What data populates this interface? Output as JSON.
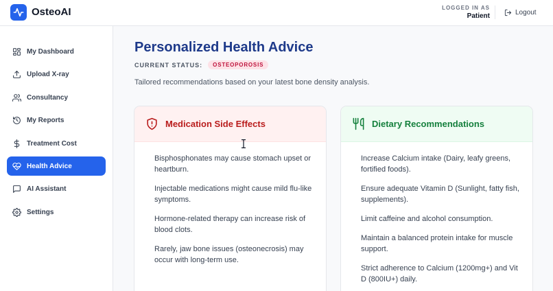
{
  "app": {
    "name": "OsteoAI"
  },
  "header": {
    "logged_in_label": "LOGGED IN AS",
    "user_role": "Patient",
    "logout_label": "Logout"
  },
  "sidebar": {
    "items": [
      {
        "label": "My Dashboard",
        "icon": "dashboard-grid-icon",
        "active": false
      },
      {
        "label": "Upload X-ray",
        "icon": "upload-icon",
        "active": false
      },
      {
        "label": "Consultancy",
        "icon": "users-icon",
        "active": false
      },
      {
        "label": "My Reports",
        "icon": "history-icon",
        "active": false
      },
      {
        "label": "Treatment Cost",
        "icon": "dollar-icon",
        "active": false
      },
      {
        "label": "Health Advice",
        "icon": "heart-pulse-icon",
        "active": true
      },
      {
        "label": "AI Assistant",
        "icon": "chat-icon",
        "active": false
      },
      {
        "label": "Settings",
        "icon": "gear-icon",
        "active": false
      }
    ]
  },
  "main": {
    "title": "Personalized Health Advice",
    "status_label": "CURRENT STATUS:",
    "status_value": "OSTEOPOROSIS",
    "subtitle": "Tailored recommendations based on your latest bone density analysis.",
    "cards": {
      "side_effects": {
        "title": "Medication Side Effects",
        "icon": "shield-alert-icon",
        "items": [
          "Bisphosphonates may cause stomach upset or heartburn.",
          "Injectable medications might cause mild flu-like symptoms.",
          "Hormone-related therapy can increase risk of blood clots.",
          "Rarely, jaw bone issues (osteonecrosis) may occur with long-term use."
        ]
      },
      "dietary": {
        "title": "Dietary Recommendations",
        "icon": "utensils-icon",
        "items": [
          "Increase Calcium intake (Dairy, leafy greens, fortified foods).",
          "Ensure adequate Vitamin D (Sunlight, fatty fish, supplements).",
          "Limit caffeine and alcohol consumption.",
          "Maintain a balanced protein intake for muscle support.",
          "Strict adherence to Calcium (1200mg+) and Vit D (800IU+) daily."
        ]
      }
    }
  },
  "colors": {
    "primary": "#2563eb",
    "title": "#1e3a8a",
    "danger": "#b91c1c",
    "success": "#15803d"
  }
}
